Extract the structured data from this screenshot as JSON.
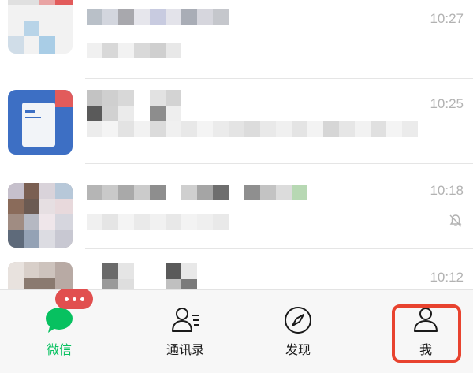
{
  "chats": [
    {
      "time": "10:27",
      "muted": false
    },
    {
      "time": "10:25",
      "muted": false
    },
    {
      "time": "10:18",
      "muted": true
    },
    {
      "time": "10:12",
      "muted": false
    }
  ],
  "tabbar": {
    "tabs": [
      {
        "label": "微信",
        "icon": "chat-bubble-icon",
        "active": true
      },
      {
        "label": "通讯录",
        "icon": "contacts-icon",
        "active": false
      },
      {
        "label": "发现",
        "icon": "compass-icon",
        "active": false
      },
      {
        "label": "我",
        "icon": "person-icon",
        "active": false
      }
    ],
    "badge": "unread-dots"
  },
  "colors": {
    "accent": "#07c160",
    "badge": "#e14f4f",
    "highlight": "#e8432f",
    "time": "#b2b2b2"
  }
}
